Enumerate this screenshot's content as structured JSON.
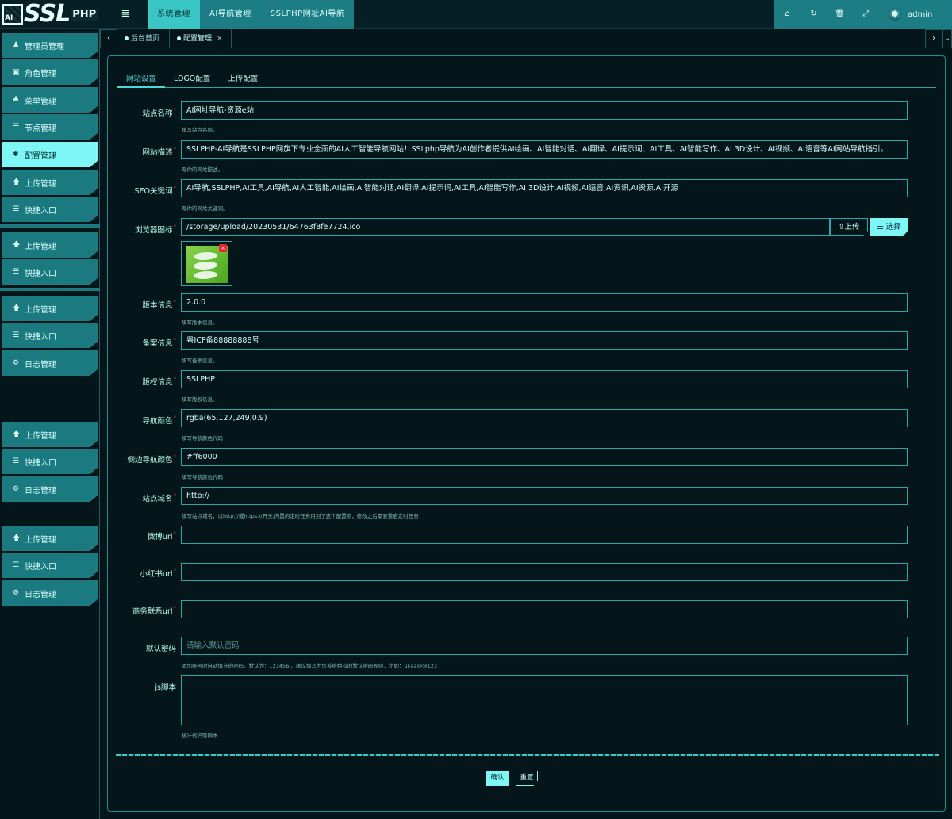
{
  "logo": {
    "badge": "AI",
    "text": "SSL",
    "sub": "PHP"
  },
  "header": {
    "menu_icon": "≣",
    "nav": [
      "系统管理",
      "AI导航管理",
      "SSLPHP网址AI导航"
    ],
    "tools": [
      "⌂",
      "↻",
      "🗑",
      "⤢"
    ],
    "username": "admin"
  },
  "sidebar": {
    "items": [
      {
        "icon": "♟",
        "label": "管理员管理"
      },
      {
        "icon": "▣",
        "label": "角色管理"
      },
      {
        "icon": "♣",
        "label": "菜单管理"
      },
      {
        "icon": "☰",
        "label": "节点管理"
      },
      {
        "icon": "✱",
        "label": "配置管理"
      },
      {
        "icon": "🡅",
        "label": "上传管理"
      },
      {
        "icon": "☰",
        "label": "快捷入口"
      },
      {
        "icon": "🡅",
        "label": "上传管理"
      },
      {
        "icon": "☰",
        "label": "快捷入口"
      },
      {
        "icon": "🡅",
        "label": "上传管理"
      },
      {
        "icon": "☰",
        "label": "快捷入口"
      },
      {
        "icon": "⚙",
        "label": "日志管理"
      },
      {
        "icon": "🡅",
        "label": "上传管理"
      },
      {
        "icon": "☰",
        "label": "快捷入口"
      },
      {
        "icon": "⚙",
        "label": "日志管理"
      },
      {
        "icon": "🡅",
        "label": "上传管理"
      },
      {
        "icon": "☰",
        "label": "快捷入口"
      },
      {
        "icon": "⚙",
        "label": "日志管理"
      }
    ]
  },
  "tabs": {
    "prev": "‹",
    "next": "›",
    "more": "⌄",
    "items": [
      {
        "label": "后台首页"
      },
      {
        "label": "配置管理",
        "close": "×"
      }
    ]
  },
  "subtabs": [
    "网站设置",
    "LOGO配置",
    "上传配置"
  ],
  "form": {
    "site_name": {
      "label": "站点名称",
      "value": "AI网址导航-资源e站",
      "help": "填写站点名称。"
    },
    "site_desc": {
      "label": "网站描述",
      "value": "SSLPHP-AI导航是SSLPHP网旗下专业全面的AI人工智能导航网站！SSLphp导航为AI创作者提供AI绘画、AI智能对话、AI翻译、AI提示词、AI工具、AI智能写作、AI 3D设计、AI视频、AI语音等AI网站导航指引。",
      "help": "写你的网站描述。"
    },
    "seo_keywords": {
      "label": "SEO关键词",
      "value": "AI导航,SSLPHP,AI工具,AI导航,AI人工智能,AI绘画,AI智能对话,AI翻译,AI提示词,AI工具,AI智能写作,AI 3D设计,AI视频,AI语音,AI资讯,AI资源,AI开源",
      "help": "写你的网站关键词。"
    },
    "favicon": {
      "label": "浏览器图标",
      "value": "/storage/upload/20230531/64763f8fe7724.ico",
      "upload": "⇪上传",
      "choose": "☰ 选择",
      "delete": "×"
    },
    "version": {
      "label": "版本信息",
      "value": "2.0.0",
      "help": "填写版本信息。"
    },
    "icp": {
      "label": "备案信息",
      "value": "粤ICP备88888888号",
      "help": "填写备案信息。"
    },
    "copyright": {
      "label": "版权信息",
      "value": "SSLPHP",
      "help": "填写版权信息。"
    },
    "nav_color": {
      "label": "导航颜色",
      "value": "rgba(65,127,249,0.9)",
      "help": "填写导航颜色代码"
    },
    "side_color": {
      "label": "侧边导航颜色",
      "value": "#ff6000",
      "help": "填写导航颜色代码"
    },
    "domain": {
      "label": "站点域名",
      "value": "http://",
      "help": "填写站点域名，以http://或https://开头,内置的定时任务用到了这个配置项，修改之后需要重启定时任务"
    },
    "weibo": {
      "label": "微博url",
      "value": ""
    },
    "xhs": {
      "label": "小红书url",
      "value": ""
    },
    "biz": {
      "label": "商务联系url",
      "value": ""
    },
    "default_pwd": {
      "label": "默认密码",
      "placeholder": "请输入默认密码",
      "help": "添加账号时自动填充的密码。默认为：123456 。建议填写为您系统特有的默认密码规则，比如：ul-aa@@123"
    },
    "js": {
      "label": "js脚本",
      "value": "",
      "help": "统计代码等脚本"
    },
    "required_mark": "*"
  },
  "buttons": {
    "confirm": "确认",
    "reset": "重置"
  },
  "colors": {
    "accent": "#7ff6f6",
    "nav_bg": "#1c7e84",
    "bg": "#04161a"
  }
}
